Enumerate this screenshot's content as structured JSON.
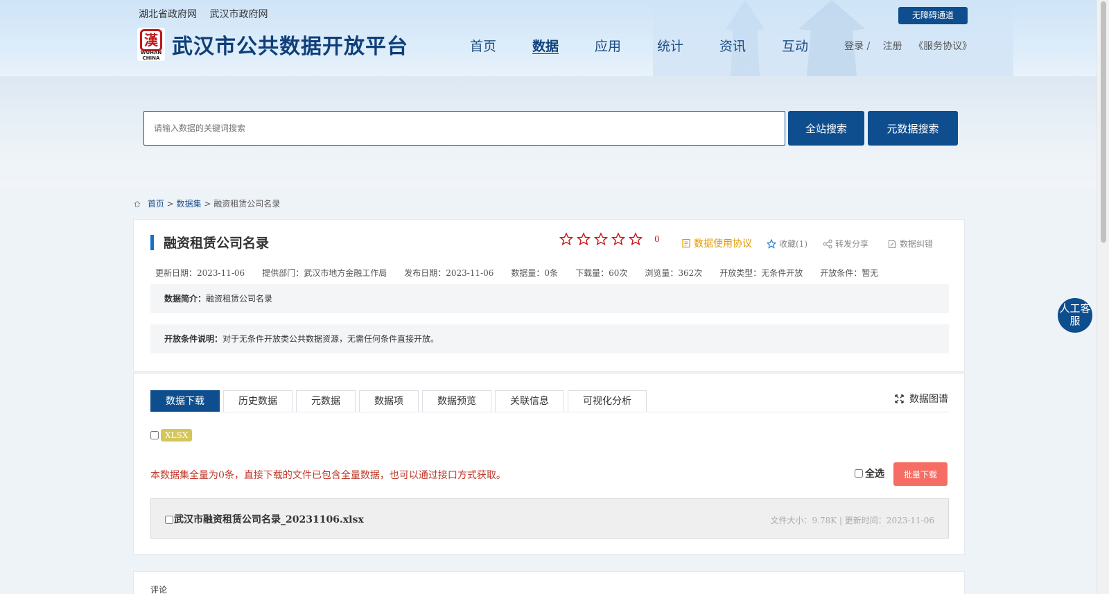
{
  "header": {
    "gov_links": [
      "湖北省政府网",
      "武汉市政府网"
    ],
    "logo_title": "武汉市公共数据开放平台",
    "logo_seal": "漢",
    "logo_sub": "WUHAN CHINA",
    "nav": [
      {
        "label": "首页",
        "active": false
      },
      {
        "label": "数据",
        "active": true
      },
      {
        "label": "应用",
        "active": false
      },
      {
        "label": "统计",
        "active": false
      },
      {
        "label": "资讯",
        "active": false
      },
      {
        "label": "互动",
        "active": false
      }
    ],
    "login": "登录 /",
    "register": "注册",
    "agreement": "《服务协议》",
    "barrier_free": "无障碍通道"
  },
  "search": {
    "placeholder": "请输入数据的关键词搜索",
    "site_search": "全站搜索",
    "meta_search": "元数据搜索"
  },
  "breadcrumb": {
    "home": "首页",
    "sep1": " > ",
    "datasets": "数据集",
    "sep2": " > ",
    "current": "融资租赁公司名录"
  },
  "dataset": {
    "title": "融资租赁公司名录",
    "rating_score": "0",
    "rating_max": 5,
    "actions": {
      "usage_agreement": "数据使用协议",
      "favorite": "收藏(1)",
      "share": "转发分享",
      "correction": "数据纠错"
    },
    "meta": {
      "updated": "更新日期：2023-11-06",
      "department": "提供部门：武汉市地方金融工作局",
      "published": "发布日期：2023-11-06",
      "count": "数据量：0条",
      "downloads": "下载量：60次",
      "views": "浏览量：362次",
      "open_type": "开放类型：无条件开放",
      "open_condition": "开放条件：暂无"
    },
    "intro_label": "数据简介：",
    "intro_text": "融资租赁公司名录",
    "condition_label": "开放条件说明：",
    "condition_text": "对于无条件开放类公共数据资源，无需任何条件直接开放。"
  },
  "tabs": [
    {
      "label": "数据下载",
      "active": true
    },
    {
      "label": "历史数据",
      "active": false
    },
    {
      "label": "元数据",
      "active": false
    },
    {
      "label": "数据项",
      "active": false
    },
    {
      "label": "数据预览",
      "active": false
    },
    {
      "label": "关联信息",
      "active": false
    },
    {
      "label": "可视化分析",
      "active": false
    }
  ],
  "graph_link": "数据图谱",
  "download": {
    "format_badge": "XLSX",
    "notice": "本数据集全量为0条，直接下载的文件已包含全量数据，也可以通过接口方式获取。",
    "select_all": "全选",
    "batch_download": "批量下载",
    "file": {
      "name": "武汉市融资租赁公司名录_20231106.xlsx",
      "meta": "文件大小：9.78K | 更新时间：2023-11-06"
    }
  },
  "comments_label": "评论",
  "service_button": "人工客服",
  "colors": {
    "primary": "#0e4e8e",
    "accent_blue": "#1a70c8",
    "star_red": "#c8161d",
    "agreement_orange": "#e29b00",
    "notice_red": "#c0392b",
    "batch_btn": "#f66d63",
    "badge_gold": "#d4c65a"
  },
  "icons": [
    "home-icon",
    "star-outline-icon",
    "document-icon",
    "star-favorite-icon",
    "share-icon",
    "edit-document-icon",
    "expand-icon"
  ]
}
